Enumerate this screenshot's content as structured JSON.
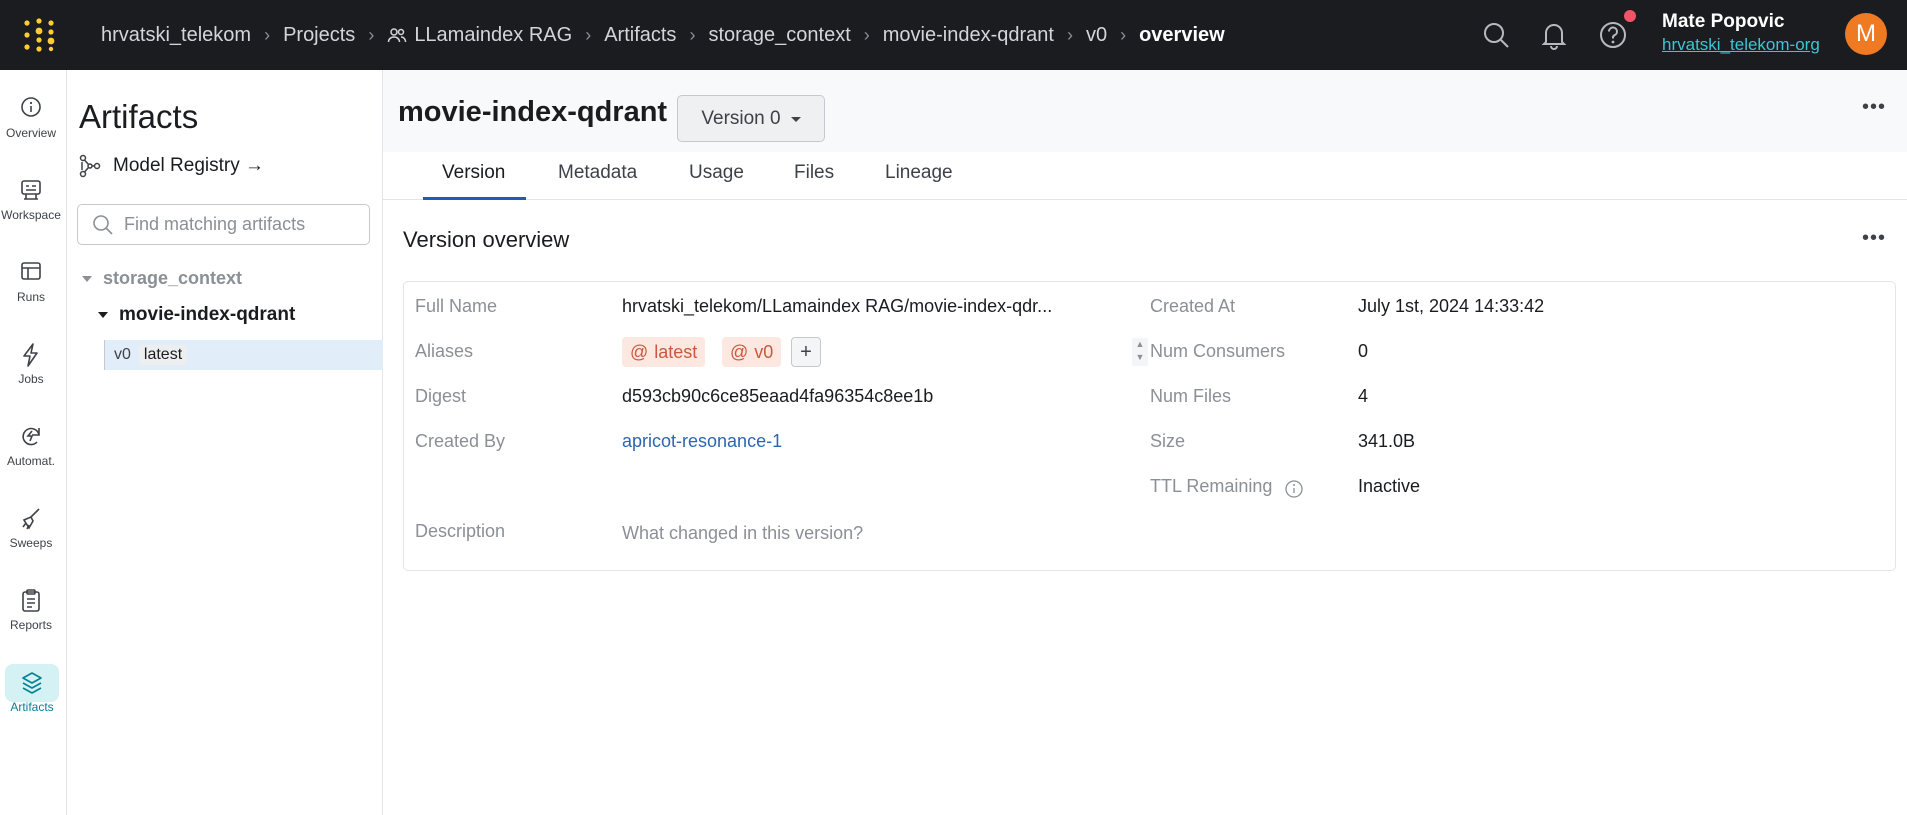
{
  "topbar": {
    "breadcrumbs": [
      "hrvatski_telekom",
      "Projects",
      "LLamaindex RAG",
      "Artifacts",
      "storage_context",
      "movie-index-qdrant",
      "v0",
      "overview"
    ],
    "user_name": "Mate Popovic",
    "user_org": "hrvatski_telekom-org",
    "avatar_letter": "M",
    "icons": [
      "search-icon",
      "bell-icon",
      "help-icon"
    ]
  },
  "leftnav": {
    "items": [
      {
        "label": "Overview",
        "icon": "info-icon"
      },
      {
        "label": "Workspace",
        "icon": "workspace-icon"
      },
      {
        "label": "Runs",
        "icon": "table-icon"
      },
      {
        "label": "Jobs",
        "icon": "lightning-icon"
      },
      {
        "label": "Automat.",
        "icon": "automation-icon"
      },
      {
        "label": "Sweeps",
        "icon": "broom-icon"
      },
      {
        "label": "Reports",
        "icon": "clipboard-icon"
      },
      {
        "label": "Artifacts",
        "icon": "layers-icon",
        "active": true
      }
    ]
  },
  "sidebar": {
    "title": "Artifacts",
    "registry_link": "Model Registry →",
    "search_placeholder": "Find matching artifacts",
    "tree": {
      "type_name": "storage_context",
      "collection": "movie-index-qdrant",
      "version": "v0",
      "version_alias": "latest"
    }
  },
  "main": {
    "title": "movie-index-qdrant",
    "version_select": "Version 0",
    "tabs": [
      "Version",
      "Metadata",
      "Usage",
      "Files",
      "Lineage"
    ],
    "active_tab": "Version",
    "section_title": "Version overview",
    "fields": {
      "full_name_label": "Full Name",
      "full_name": "hrvatski_telekom/LLamaindex RAG/movie-index-qdr...",
      "aliases_label": "Aliases",
      "aliases": [
        "latest",
        "v0"
      ],
      "digest_label": "Digest",
      "digest": "d593cb90c6ce85eaad4fa96354c8ee1b",
      "created_by_label": "Created By",
      "created_by": "apricot-resonance-1",
      "description_label": "Description",
      "description_placeholder": "What changed in this version?",
      "created_at_label": "Created At",
      "created_at": "July 1st, 2024 14:33:42",
      "num_consumers_label": "Num Consumers",
      "num_consumers": "0",
      "num_files_label": "Num Files",
      "num_files": "4",
      "size_label": "Size",
      "size": "341.0B",
      "ttl_label": "TTL Remaining",
      "ttl": "Inactive"
    }
  },
  "colors": {
    "topbar_bg": "#1a1c1f",
    "accent_teal": "#038194",
    "org_link": "#3cc6d6",
    "avatar": "#ef7a24",
    "alias_bg": "#fde7e1",
    "alias_text": "#c9593c",
    "link": "#2b66b0",
    "tab_underline": "#1a5fb4"
  }
}
